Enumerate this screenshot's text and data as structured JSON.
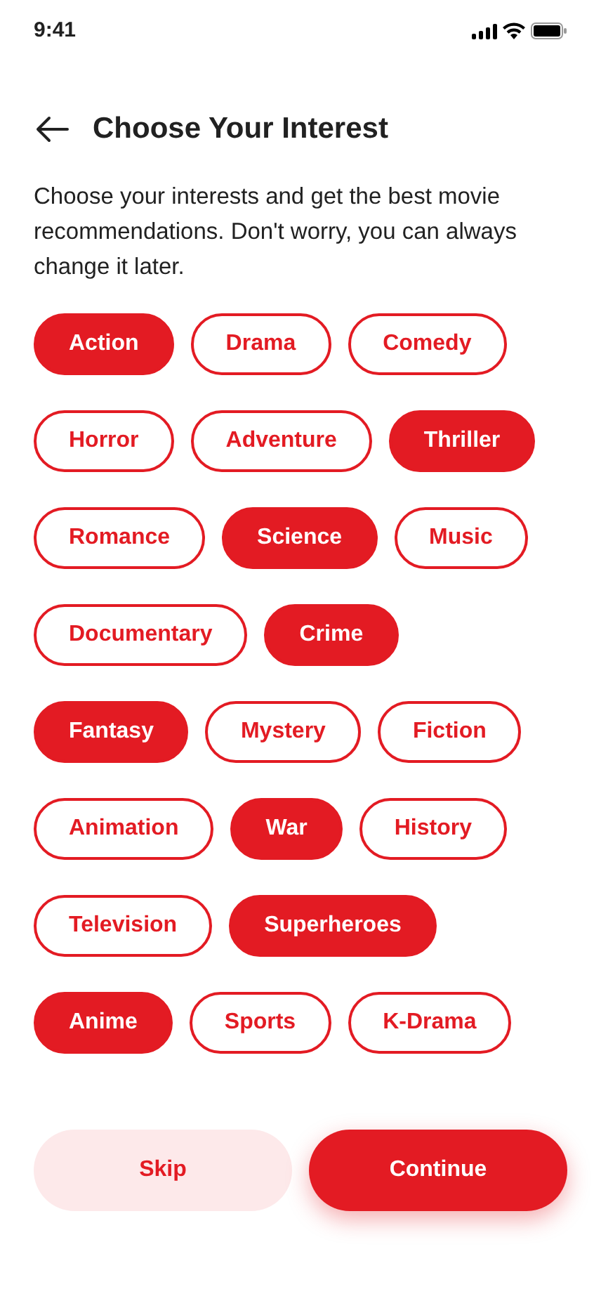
{
  "status_bar": {
    "time": "9:41"
  },
  "header": {
    "title": "Choose Your Interest"
  },
  "description": "Choose your interests and get the best movie recommendations. Don't worry, you can always change it later.",
  "interest_rows": [
    {
      "chips": [
        {
          "label": "Action",
          "selected": true
        },
        {
          "label": "Drama",
          "selected": false
        },
        {
          "label": "Comedy",
          "selected": false
        }
      ]
    },
    {
      "chips": [
        {
          "label": "Horror",
          "selected": false
        },
        {
          "label": "Adventure",
          "selected": false
        },
        {
          "label": "Thriller",
          "selected": true
        }
      ]
    },
    {
      "chips": [
        {
          "label": "Romance",
          "selected": false
        },
        {
          "label": "Science",
          "selected": true
        },
        {
          "label": "Music",
          "selected": false
        }
      ]
    },
    {
      "chips": [
        {
          "label": "Documentary",
          "selected": false
        },
        {
          "label": "Crime",
          "selected": true
        }
      ]
    },
    {
      "chips": [
        {
          "label": "Fantasy",
          "selected": true
        },
        {
          "label": "Mystery",
          "selected": false
        },
        {
          "label": "Fiction",
          "selected": false
        }
      ]
    },
    {
      "chips": [
        {
          "label": "Animation",
          "selected": false
        },
        {
          "label": "War",
          "selected": true
        },
        {
          "label": "History",
          "selected": false
        }
      ]
    },
    {
      "chips": [
        {
          "label": "Television",
          "selected": false
        },
        {
          "label": "Superheroes",
          "selected": true
        }
      ]
    },
    {
      "chips": [
        {
          "label": "Anime",
          "selected": true
        },
        {
          "label": "Sports",
          "selected": false
        },
        {
          "label": "K-Drama",
          "selected": false
        }
      ]
    }
  ],
  "buttons": [
    {
      "label": "Skip",
      "kind": "secondary"
    },
    {
      "label": "Continue",
      "kind": "primary"
    }
  ]
}
